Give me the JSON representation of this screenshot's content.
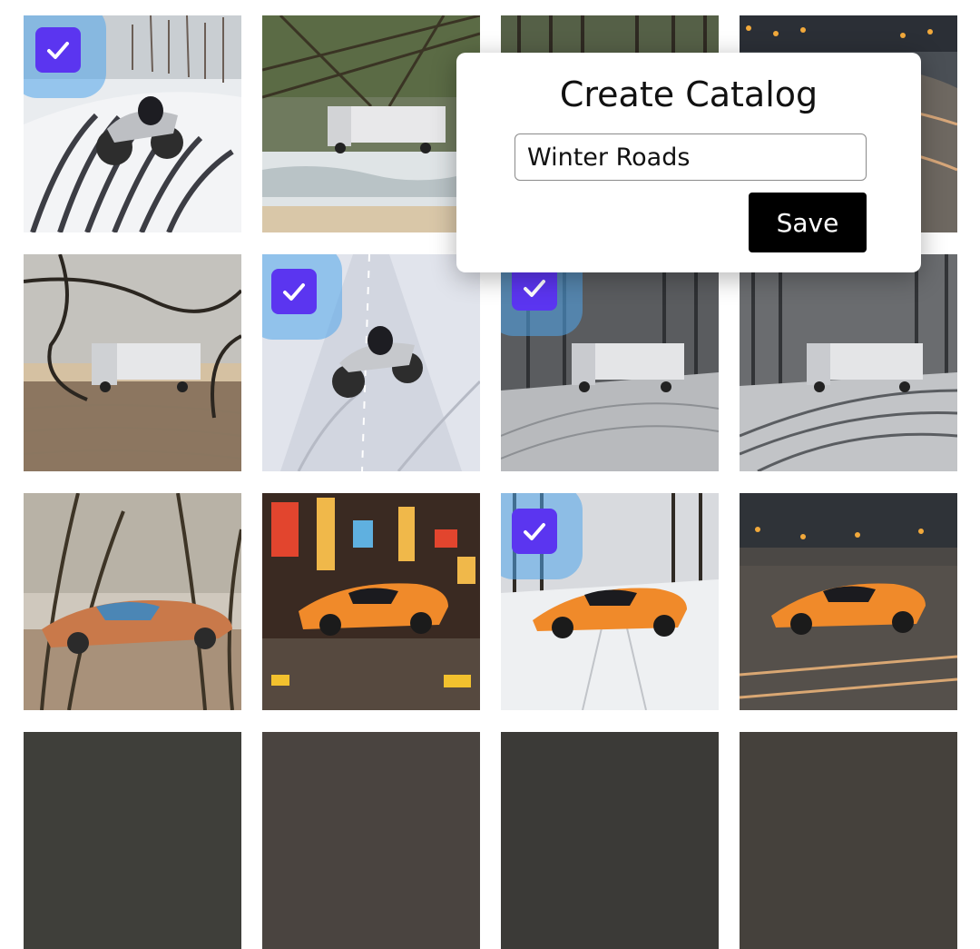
{
  "dialog": {
    "title": "Create Catalog",
    "name_value": "Winter Roads",
    "save_label": "Save"
  },
  "colors": {
    "check_fill": "#5b35f0",
    "check_halo": "#50a5eb",
    "save_bg": "#000000"
  },
  "gallery": {
    "tiles": [
      {
        "scene": "motorcycle on snowy road",
        "selected": true
      },
      {
        "scene": "truck on beach with palm fronds",
        "selected": false
      },
      {
        "scene": "forest road",
        "selected": false
      },
      {
        "scene": "city road at night with lights",
        "selected": false
      },
      {
        "scene": "truck on sandy beach with trees",
        "selected": false
      },
      {
        "scene": "motorcycle on snowy road",
        "selected": true
      },
      {
        "scene": "truck on snowy forest road",
        "selected": true
      },
      {
        "scene": "truck on snowy forest road",
        "selected": false
      },
      {
        "scene": "retro car on palm beach",
        "selected": false
      },
      {
        "scene": "orange sports car in neon city",
        "selected": false
      },
      {
        "scene": "orange sports car on snowy forest road",
        "selected": true
      },
      {
        "scene": "orange sports car on city highway",
        "selected": false
      },
      {
        "scene": "partial tile",
        "selected": false
      },
      {
        "scene": "partial tile",
        "selected": false
      },
      {
        "scene": "partial tile",
        "selected": false
      },
      {
        "scene": "partial tile",
        "selected": false
      }
    ]
  }
}
